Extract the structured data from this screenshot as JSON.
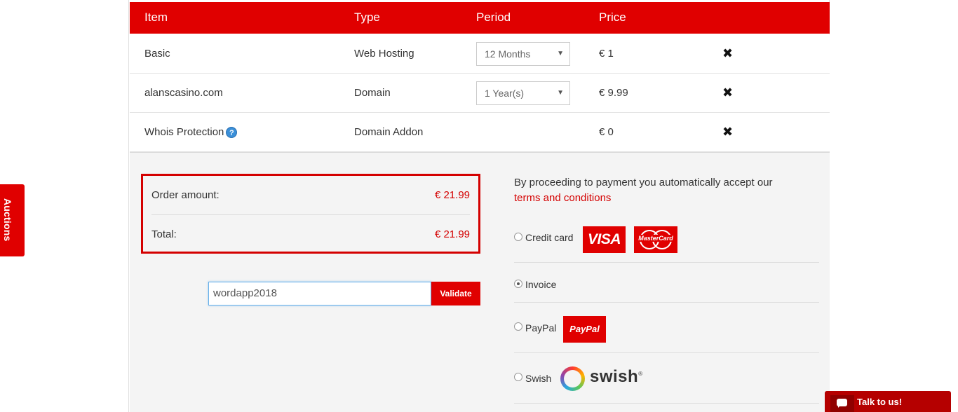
{
  "side_tab": {
    "label": "Auctions"
  },
  "table": {
    "headers": {
      "item": "Item",
      "type": "Type",
      "period": "Period",
      "price": "Price"
    },
    "rows": [
      {
        "item": "Basic",
        "type": "Web Hosting",
        "period": "12 Months",
        "price": "€ 1"
      },
      {
        "item": "alanscasino.com",
        "type": "Domain",
        "period": "1 Year(s)",
        "price": "€ 9.99"
      },
      {
        "item": "Whois Protection",
        "type": "Domain Addon",
        "price": "€ 0"
      }
    ],
    "remove_symbol": "✖",
    "help_symbol": "?"
  },
  "summary": {
    "order_amount_label": "Order amount:",
    "order_amount_value": "€ 21.99",
    "total_label": "Total:",
    "total_value": "€ 21.99"
  },
  "promo": {
    "value": "wordapp2018",
    "button": "Validate"
  },
  "payment": {
    "accept_text": "By proceeding to payment you automatically accept our",
    "terms_link": "terms and conditions",
    "options": [
      {
        "label": "Credit card",
        "checked": false
      },
      {
        "label": "Invoice",
        "checked": true
      },
      {
        "label": "PayPal",
        "checked": false
      },
      {
        "label": "Swish",
        "checked": false
      }
    ],
    "logos": {
      "visa": "VISA",
      "mastercard": "MasterCard",
      "paypal": "PayPal",
      "swish": "swish",
      "swish_mark": "®"
    }
  },
  "chat": {
    "label": "Talk to us!"
  },
  "colors": {
    "accent": "#e00000",
    "link": "#d40000",
    "panel_bg": "#f4f4f4"
  }
}
